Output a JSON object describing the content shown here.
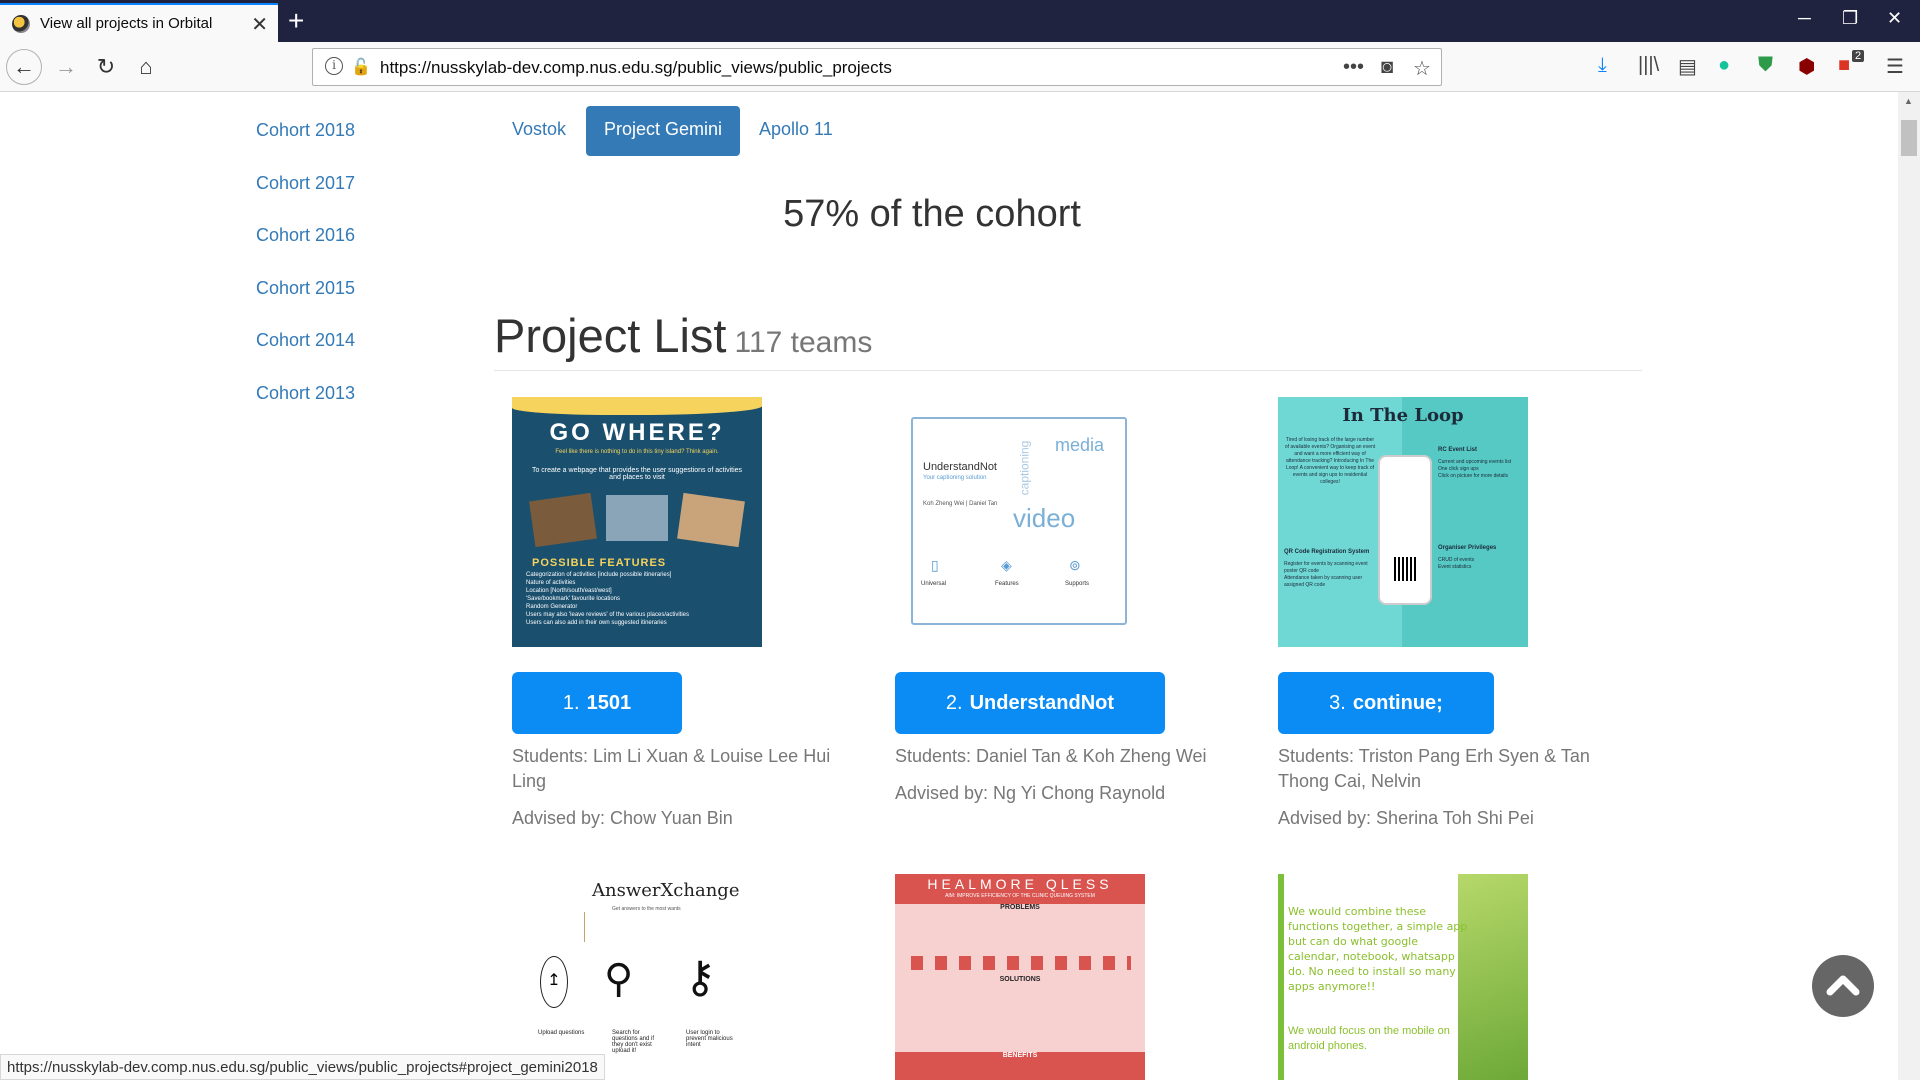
{
  "browser": {
    "tab_title": "View all projects in Orbital",
    "url": "https://nusskylab-dev.comp.nus.edu.sg/public_views/public_projects",
    "status_url": "https://nusskylab-dev.comp.nus.edu.sg/public_views/public_projects#project_gemini2018",
    "extension_badge": "2"
  },
  "sidebar": {
    "items": [
      "Cohort 2018",
      "Cohort 2017",
      "Cohort 2016",
      "Cohort 2015",
      "Cohort 2014",
      "Cohort 2013"
    ]
  },
  "levels": {
    "tabs": [
      "Vostok",
      "Project Gemini",
      "Apollo 11"
    ],
    "active": "Project Gemini"
  },
  "stat": "57% of the cohort",
  "project_list": {
    "title": "Project List",
    "count": "117 teams"
  },
  "projects": [
    {
      "number": "1.",
      "name": "1501",
      "students": "Students: Lim Li Xuan & Louise Lee Hui Ling",
      "advisor": "Advised by: Chow Yuan Bin",
      "poster": {
        "title": "GO WHERE?",
        "tagline": "Feel like there is nothing to do in this tiny island? Think again.",
        "desc": "To create a webpage that provides the user suggestions of activities and places to visit",
        "features_title": "POSSIBLE FEATURES",
        "features": [
          "Categorization of activities [include possible itineraries]",
          "Nature of activities",
          "Location [North/south/east/west]",
          "'Save/bookmark' favourite locations",
          "Random Generator",
          "Users may also 'leave reviews' of the various places/activities",
          "Users can also add in their own suggested itineraries"
        ]
      }
    },
    {
      "number": "2.",
      "name": "UnderstandNot",
      "students": "Students: Daniel Tan & Koh Zheng Wei",
      "advisor": "Advised by: Ng Yi Chong Raynold",
      "poster": {
        "title": "UnderstandNot",
        "tagline": "Your captioning solution",
        "authors": "Koh Zheng Wei | Daniel Tan",
        "cloud": [
          "media",
          "captioning",
          "video"
        ],
        "features": [
          "Universal",
          "Features",
          "Supports"
        ]
      }
    },
    {
      "number": "3.",
      "name": "continue;",
      "students": "Students: Triston Pang Erh Syen & Tan Thong Cai, Nelvin",
      "advisor": "Advised by: Sherina Toh Shi Pei",
      "poster": {
        "title": "In The Loop",
        "intro": "Tired of losing track of the large number of available events? Organising an event and want a more efficient way of attendance tracking? Introducing In The Loop! A convenient way to keep track of events and sign ups to residential colleges!",
        "rc_title": "RC Event List",
        "rc_items": [
          "Current and upcoming events list",
          "One click sign ups",
          "Click on picture for more details"
        ],
        "qr_title": "QR Code Registration System",
        "qr_items": [
          "Register for events by scanning event poster QR code",
          "Attendance taken by scanning user assigned QR code"
        ],
        "org_title": "Organiser Privileges",
        "org_items": [
          "CRUD of events",
          "Event statistics"
        ]
      }
    },
    {
      "poster": {
        "title": "AnswerXchange",
        "tagline": "Get answers to the most wants",
        "items": [
          "Upload questions",
          "Search for questions and if they don't exist upload it!",
          "User login to prevent malicious intent"
        ]
      }
    },
    {
      "poster": {
        "title": "HEALMORE QLESS",
        "subtitle": "AIM: IMPROVE EFFICIENCY OF THE CLINIC QUEUING SYSTEM",
        "sections": [
          "PROBLEMS",
          "SOLUTIONS",
          "BENEFITS"
        ]
      }
    },
    {
      "poster": {
        "text1": "We would combine these functions together, a simple app but can do what google calendar, notebook, whatsapp do. No need to install so many apps anymore!!",
        "text2": "We would focus on the mobile on android phones."
      }
    }
  ],
  "colors": {
    "link": "#337ab7",
    "button": "#0b8cf5",
    "titlebar": "#202340"
  }
}
